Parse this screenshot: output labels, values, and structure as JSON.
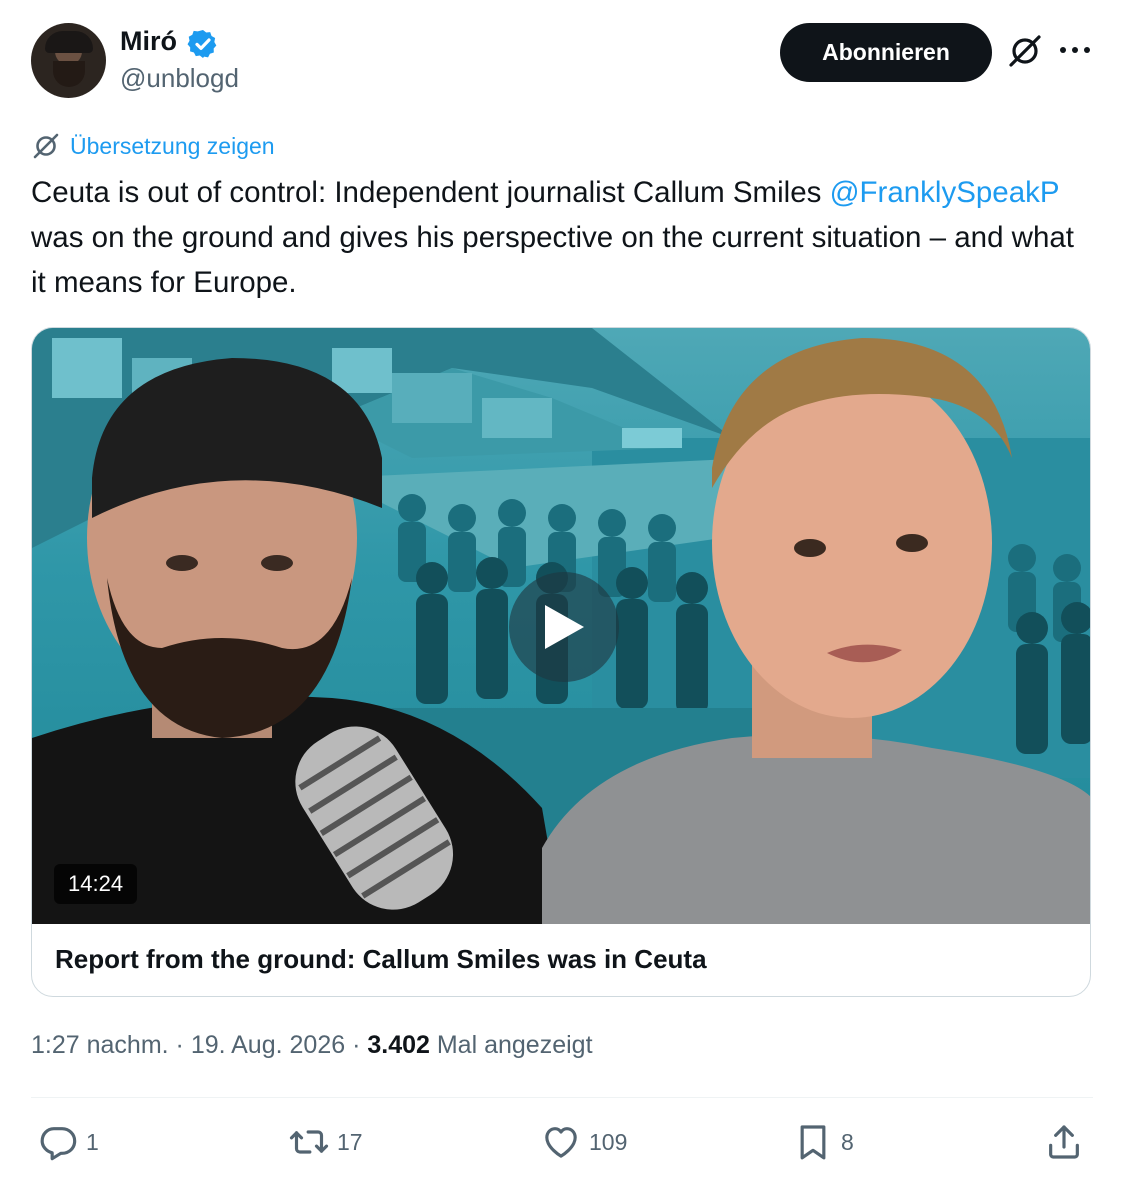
{
  "author": {
    "name": "Miró",
    "handle": "@unblogd",
    "verified": true
  },
  "header": {
    "follow_label": "Abonnieren",
    "grok_icon": "grok-icon",
    "more_icon": "more-icon"
  },
  "translate": {
    "label": "Übersetzung zeigen",
    "icon": "grok-icon"
  },
  "tweet": {
    "text_before": "Ceuta is out of control: Independent journalist Callum Smiles ",
    "mention": "@FranklySpeakP",
    "text_after": " was on the ground and gives his perspective on the current situation – and what it means for Europe."
  },
  "media": {
    "duration": "14:24",
    "title": "Report from the ground: Callum Smiles was in Ceuta",
    "play_icon": "play-icon"
  },
  "meta": {
    "time": "1:27 nachm.",
    "separator": " · ",
    "date": "19. Aug. 2026",
    "views": "3.402",
    "views_label": "Mal angezeigt"
  },
  "actions": {
    "replies": "1",
    "reposts": "17",
    "likes": "109",
    "bookmarks": "8"
  },
  "colors": {
    "accent": "#1d9bf0",
    "text": "#0f1419",
    "secondary": "#536471",
    "border": "#cfd9de",
    "button_bg": "#0f1419"
  }
}
